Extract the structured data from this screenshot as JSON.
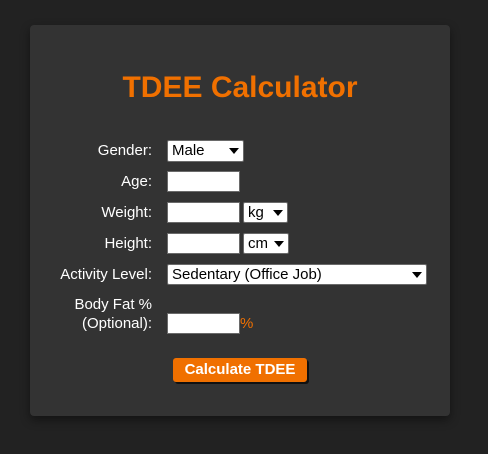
{
  "title": "TDEE Calculator",
  "fields": {
    "gender": {
      "label": "Gender:",
      "value": "Male"
    },
    "age": {
      "label": "Age:",
      "value": ""
    },
    "weight": {
      "label": "Weight:",
      "value": "",
      "unit": "kg"
    },
    "height": {
      "label": "Height:",
      "value": "",
      "unit": "cm"
    },
    "activity": {
      "label": "Activity Level:",
      "value": "Sedentary (Office Job)"
    },
    "body_fat": {
      "label_line1": "Body Fat %",
      "label_line2": "(Optional):",
      "value": "",
      "suffix": "%"
    }
  },
  "submit_label": "Calculate TDEE",
  "colors": {
    "accent": "#f07000",
    "card_bg": "#333333",
    "page_bg": "#222222"
  }
}
